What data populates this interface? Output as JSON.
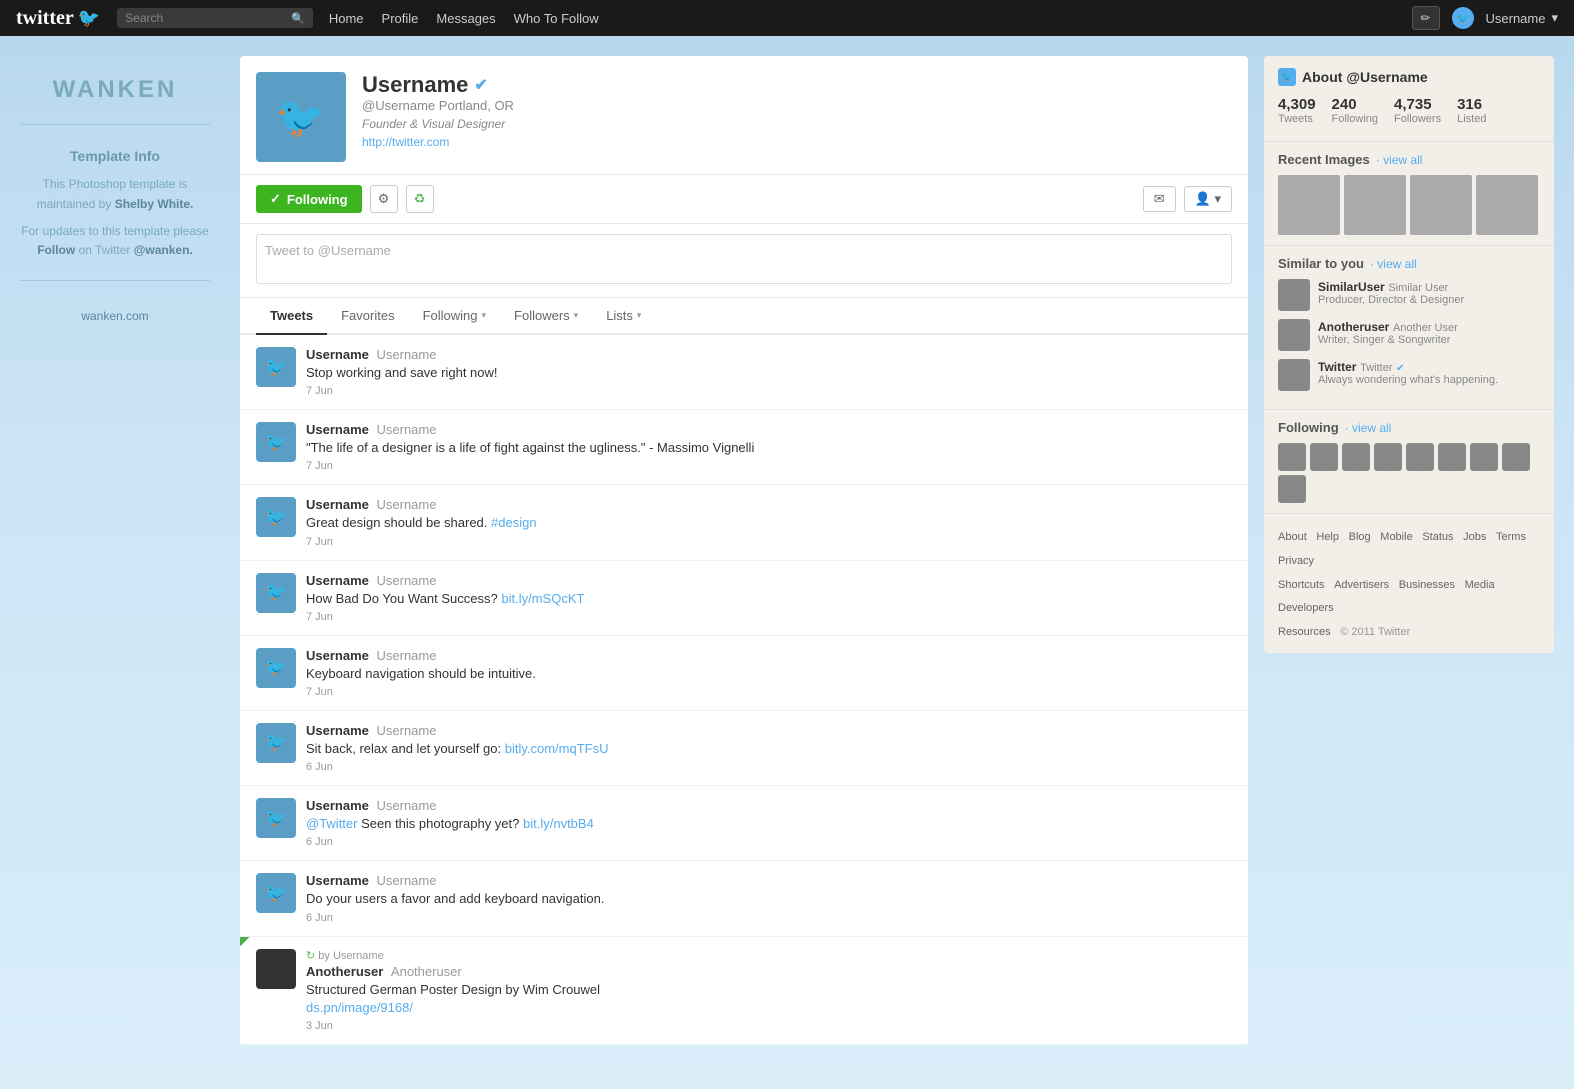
{
  "topnav": {
    "logo": "twitter",
    "bird_symbol": "🐦",
    "search_placeholder": "Search",
    "links": [
      "Home",
      "Profile",
      "Messages",
      "Who To Follow"
    ],
    "compose_symbol": "✏",
    "username": "Username",
    "dropdown_arrow": "▾"
  },
  "sidebar": {
    "brand": "WANKEN",
    "template_info_title": "Template Info",
    "template_info_text": "This Photoshop template is maintained by",
    "shelby_white": "Shelby White.",
    "follow_text": "For updates to this template please",
    "follow_label": "Follow",
    "follow_on": "on Twitter",
    "handle": "@wanken.",
    "site_link": "wanken.com"
  },
  "profile": {
    "name": "Username",
    "handle": "@Username",
    "location": "Portland, OR",
    "bio": "Founder & Visual Designer",
    "url": "http://twitter.com",
    "following_button": "Following",
    "tweet_placeholder": "Tweet to @Username"
  },
  "tabs": [
    {
      "label": "Tweets",
      "active": true,
      "has_arrow": false
    },
    {
      "label": "Favorites",
      "active": false,
      "has_arrow": false
    },
    {
      "label": "Following",
      "active": false,
      "has_arrow": true
    },
    {
      "label": "Followers",
      "active": false,
      "has_arrow": true
    },
    {
      "label": "Lists",
      "active": false,
      "has_arrow": true
    }
  ],
  "tweets": [
    {
      "username": "Username",
      "handle": "Username",
      "text": "Stop working and save right now!",
      "date": "7 Jun",
      "is_rt": false,
      "rt_by": null
    },
    {
      "username": "Username",
      "handle": "Username",
      "text": "\"The life of a designer is a life of fight against the ugliness.\" - Massimo Vignelli",
      "date": "7 Jun",
      "is_rt": false,
      "rt_by": null
    },
    {
      "username": "Username",
      "handle": "Username",
      "text": "Great design should be shared. #design",
      "date": "7 Jun",
      "is_rt": false,
      "rt_by": null,
      "link": "#design"
    },
    {
      "username": "Username",
      "handle": "Username",
      "text": "How Bad Do You Want Success?",
      "text_link": "bit.ly/mSQcKT",
      "date": "7 Jun",
      "is_rt": false
    },
    {
      "username": "Username",
      "handle": "Username",
      "text": "Keyboard navigation should be intuitive.",
      "date": "7 Jun",
      "is_rt": false
    },
    {
      "username": "Username",
      "handle": "Username",
      "text": "Sit back, relax and let yourself go:",
      "text_link": "bitly.com/mqTFsU",
      "date": "6 Jun",
      "is_rt": false
    },
    {
      "username": "Username",
      "handle": "Username",
      "text_mention": "@Twitter",
      "text": "Seen this photography yet?",
      "text_link": "bit.ly/nvtbB4",
      "date": "6 Jun",
      "is_rt": false
    },
    {
      "username": "Username",
      "handle": "Username",
      "text": "Do your users a favor and add keyboard navigation.",
      "date": "6 Jun",
      "is_rt": false
    },
    {
      "username": "Anotheruser",
      "handle": "Anotheruser",
      "rt_by": "by Username",
      "text": "Structured German Poster Design by Wim Crouwel",
      "text_link": "ds.pn/image/9168/",
      "date": "3 Jun",
      "is_rt": true,
      "dark_avatar": true
    }
  ],
  "right_sidebar": {
    "about_title": "About @Username",
    "stats": [
      {
        "num": "4,309",
        "label": "Tweets"
      },
      {
        "num": "240",
        "label": "Following"
      },
      {
        "num": "4,735",
        "label": "Followers"
      },
      {
        "num": "316",
        "label": "Listed"
      }
    ],
    "recent_images_title": "Recent Images",
    "view_all": "· view all",
    "similar_title": "Similar to you",
    "similar_users": [
      {
        "name": "SimilarUser",
        "handle": "Similar User",
        "bio": "Producer, Director & Designer",
        "verified": false
      },
      {
        "name": "Anotheruser",
        "handle": "Another User",
        "bio": "Writer, Singer & Songwriter",
        "verified": false
      },
      {
        "name": "Twitter",
        "handle": "Twitter",
        "bio": "Always wondering what's happening.",
        "verified": true
      }
    ],
    "following_title": "Following",
    "footer_links": [
      "About",
      "Help",
      "Blog",
      "Mobile",
      "Status",
      "Jobs",
      "Terms",
      "Privacy",
      "Shortcuts",
      "Advertisers",
      "Businesses",
      "Media",
      "Developers",
      "Resources"
    ],
    "copyright": "© 2011 Twitter"
  }
}
